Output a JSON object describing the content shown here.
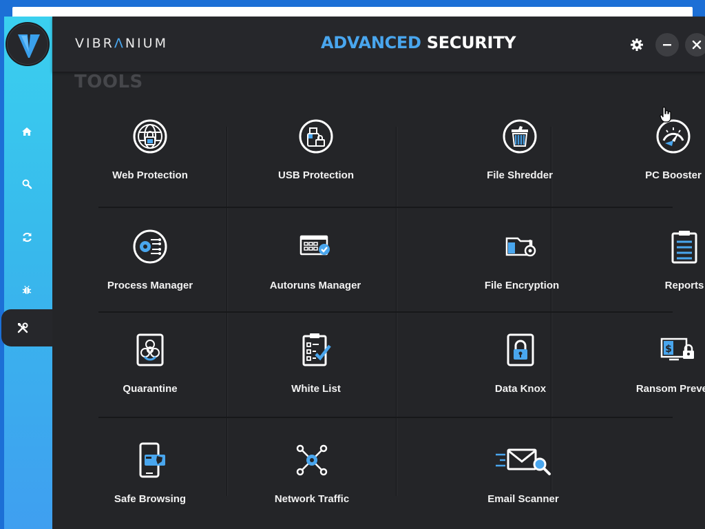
{
  "window": {
    "accent": "#1c6fd6"
  },
  "brand": {
    "name_part1": "VIBR",
    "name_mark": "Λ",
    "name_part2": "NIUM"
  },
  "header": {
    "title_part1": "ADVANCED",
    "title_part2": "SECURITY",
    "buttons": [
      "gear-icon",
      "minimize-icon",
      "close-icon"
    ]
  },
  "sidebar": {
    "items": [
      {
        "icon": "home-icon"
      },
      {
        "icon": "search-icon"
      },
      {
        "icon": "refresh-icon"
      },
      {
        "icon": "bug-icon"
      },
      {
        "icon": "tools-icon",
        "active": true
      }
    ]
  },
  "section": {
    "title": "TOOLS"
  },
  "tools": [
    {
      "label": "Web Protection",
      "icon": "globe-lock-icon"
    },
    {
      "label": "USB Protection",
      "icon": "usb-lock-icon"
    },
    {
      "label": "File Shredder",
      "icon": "shredder-icon"
    },
    {
      "label": "PC Booster",
      "icon": "speedometer-icon"
    },
    {
      "label": "Process Manager",
      "icon": "process-gear-icon"
    },
    {
      "label": "Autoruns Manager",
      "icon": "autoruns-icon"
    },
    {
      "label": "File Encryption",
      "icon": "folder-key-icon"
    },
    {
      "label": "Reports",
      "icon": "clipboard-icon"
    },
    {
      "label": "Quarantine",
      "icon": "biohazard-icon"
    },
    {
      "label": "White List",
      "icon": "checklist-icon"
    },
    {
      "label": "Data Knox",
      "icon": "padlock-icon"
    },
    {
      "label": "Ransom Prevent",
      "icon": "ransom-lock-icon"
    },
    {
      "label": "Safe Browsing",
      "icon": "phone-shield-icon"
    },
    {
      "label": "Network Traffic",
      "icon": "network-nodes-icon"
    },
    {
      "label": "Email Scanner",
      "icon": "email-search-icon"
    }
  ],
  "colors": {
    "accent": "#49a6ee",
    "sidebar_top": "#3ad0ef",
    "sidebar_bottom": "#3f9ff0",
    "panel": "#242528",
    "label": "#f2f2f2"
  }
}
